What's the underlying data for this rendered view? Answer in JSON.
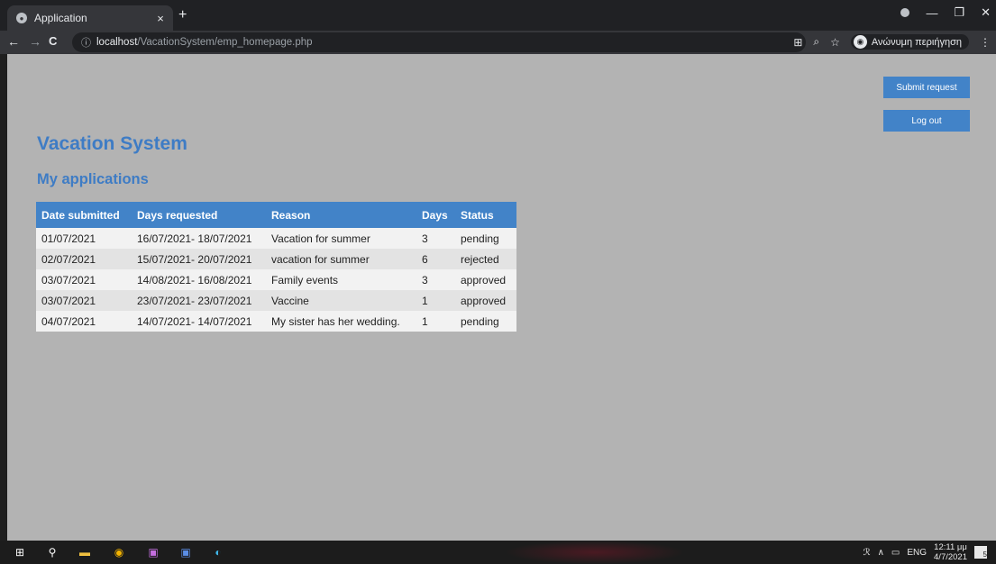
{
  "browser": {
    "tab_title": "Application",
    "tab_close": "×",
    "new_tab": "+",
    "url_host": "localhost",
    "url_path": "/VacationSystem/emp_homepage.php",
    "profile_label": "Ανώνυμη περιήγηση",
    "back": "←",
    "forward": "→",
    "reload": "C"
  },
  "page": {
    "title": "Vacation System",
    "section_title": "My applications",
    "buttons": {
      "submit": "Submit request",
      "logout": "Log out"
    }
  },
  "table": {
    "headers": [
      "Date submitted",
      "Days requested",
      "Reason",
      "Days",
      "Status"
    ],
    "rows": [
      [
        "01/07/2021",
        "16/07/2021- 18/07/2021",
        "Vacation for summer",
        "3",
        "pending"
      ],
      [
        "02/07/2021",
        "15/07/2021- 20/07/2021",
        "vacation for summer",
        "6",
        "rejected"
      ],
      [
        "03/07/2021",
        "14/08/2021- 16/08/2021",
        "Family events",
        "3",
        "approved"
      ],
      [
        "03/07/2021",
        "23/07/2021- 23/07/2021",
        "Vaccine",
        "1",
        "approved"
      ],
      [
        "04/07/2021",
        "14/07/2021- 14/07/2021",
        "My sister has her wedding.",
        "1",
        "pending"
      ]
    ]
  },
  "taskbar": {
    "language": "ENG",
    "time": "12:11 μμ",
    "date": "4/7/2021",
    "notifications": "5"
  },
  "colors": {
    "accent": "#4283c8",
    "title": "#3e7cc5",
    "page_bg": "#b3b3b3"
  }
}
